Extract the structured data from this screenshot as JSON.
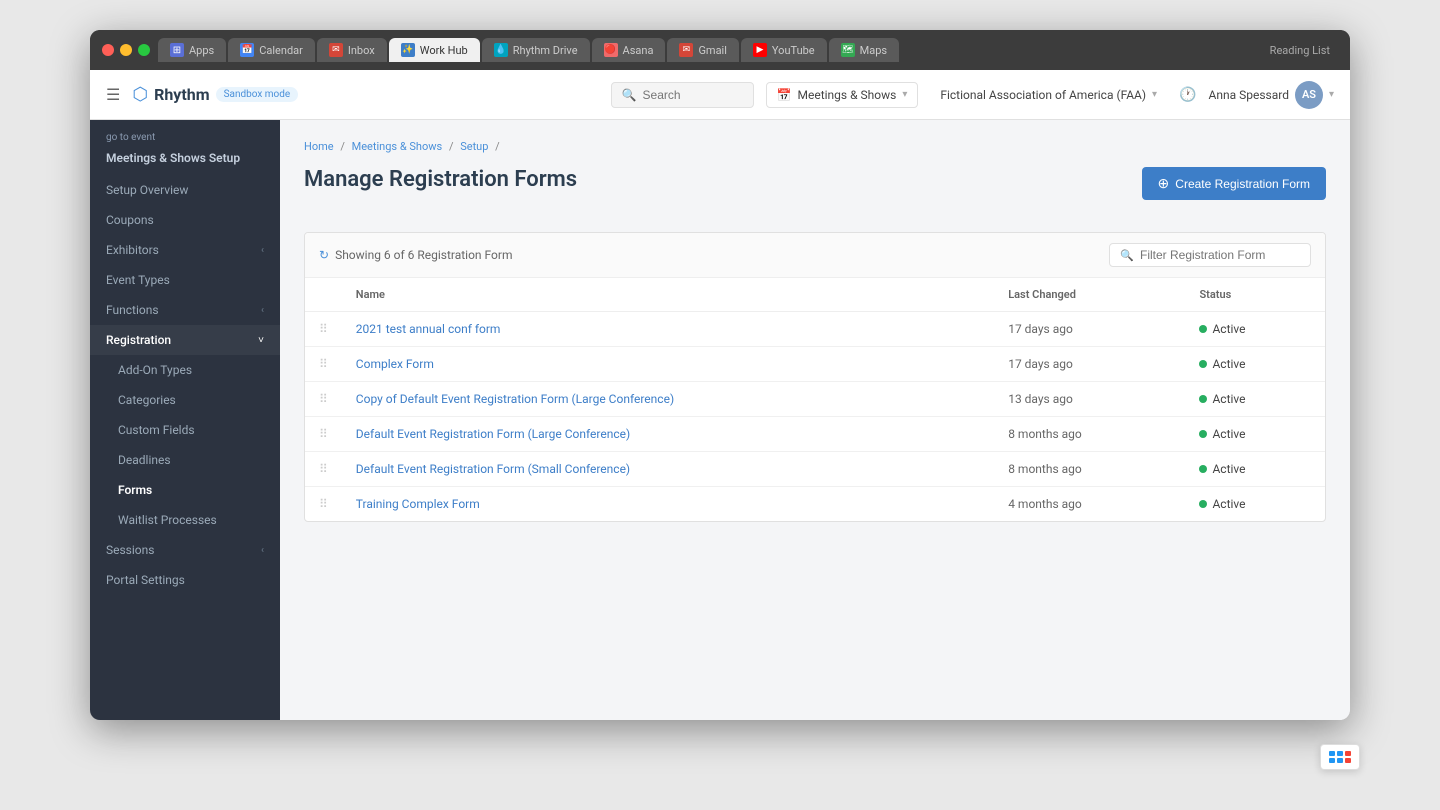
{
  "browser": {
    "tabs": [
      {
        "id": "apps",
        "label": "Apps",
        "icon": "⊞",
        "active": false
      },
      {
        "id": "calendar",
        "label": "Calendar",
        "icon": "📅",
        "active": false
      },
      {
        "id": "inbox",
        "label": "Inbox",
        "icon": "✉",
        "active": false
      },
      {
        "id": "work",
        "label": "Work Hub",
        "icon": "✨",
        "active": true
      },
      {
        "id": "rhythm-drive",
        "label": "Rhythm Drive",
        "icon": "💧",
        "active": false
      },
      {
        "id": "asana",
        "label": "Asana",
        "icon": "🔴",
        "active": false
      },
      {
        "id": "gmail",
        "label": "Gmail",
        "icon": "✉",
        "active": false
      },
      {
        "id": "youtube",
        "label": "YouTube",
        "icon": "▶",
        "active": false
      },
      {
        "id": "maps",
        "label": "Maps",
        "icon": "🗺",
        "active": false
      }
    ],
    "reading_list": "Reading List"
  },
  "header": {
    "logo_text": "Rhythm",
    "sandbox_label": "Sandbox mode",
    "search_placeholder": "Search",
    "event_name": "Meetings & Shows",
    "org_name": "Fictional Association of America (FAA)",
    "user_name": "Anna Spessard",
    "user_initials": "AS"
  },
  "sidebar": {
    "back_label": "go to event",
    "section_title": "Meetings & Shows Setup",
    "items": [
      {
        "id": "setup-overview",
        "label": "Setup Overview",
        "has_children": false,
        "active": false
      },
      {
        "id": "coupons",
        "label": "Coupons",
        "has_children": false,
        "active": false
      },
      {
        "id": "exhibitors",
        "label": "Exhibitors",
        "has_children": true,
        "active": false
      },
      {
        "id": "event-types",
        "label": "Event Types",
        "has_children": false,
        "active": false
      },
      {
        "id": "functions",
        "label": "Functions",
        "has_children": true,
        "active": false
      },
      {
        "id": "registration",
        "label": "Registration",
        "has_children": true,
        "active": true
      },
      {
        "id": "add-on-types",
        "label": "Add-On Types",
        "has_children": false,
        "active": false
      },
      {
        "id": "categories",
        "label": "Categories",
        "has_children": false,
        "active": false
      },
      {
        "id": "custom-fields",
        "label": "Custom Fields",
        "has_children": false,
        "active": false
      },
      {
        "id": "deadlines",
        "label": "Deadlines",
        "has_children": false,
        "active": false
      },
      {
        "id": "forms",
        "label": "Forms",
        "has_children": false,
        "active": true
      },
      {
        "id": "waitlist-processes",
        "label": "Waitlist Processes",
        "has_children": false,
        "active": false
      },
      {
        "id": "sessions",
        "label": "Sessions",
        "has_children": true,
        "active": false
      },
      {
        "id": "portal-settings",
        "label": "Portal Settings",
        "has_children": false,
        "active": false
      }
    ]
  },
  "breadcrumb": {
    "items": [
      "Home",
      "Meetings & Shows",
      "Setup"
    ]
  },
  "page": {
    "title": "Manage Registration Forms",
    "create_button": "Create Registration Form",
    "table": {
      "count_label": "Showing 6 of 6 Registration Form",
      "filter_placeholder": "Filter Registration Form",
      "columns": [
        "Name",
        "Last Changed",
        "Status"
      ],
      "rows": [
        {
          "name": "2021 test annual conf form",
          "last_changed": "17 days ago",
          "status": "Active"
        },
        {
          "name": "Complex Form",
          "last_changed": "17 days ago",
          "status": "Active"
        },
        {
          "name": "Copy of Default Event Registration Form (Large Conference)",
          "last_changed": "13 days ago",
          "status": "Active"
        },
        {
          "name": "Default Event Registration Form (Large Conference)",
          "last_changed": "8 months ago",
          "status": "Active"
        },
        {
          "name": "Default Event Registration Form (Small Conference)",
          "last_changed": "8 months ago",
          "status": "Active"
        },
        {
          "name": "Training Complex Form",
          "last_changed": "4 months ago",
          "status": "Active"
        }
      ]
    }
  }
}
